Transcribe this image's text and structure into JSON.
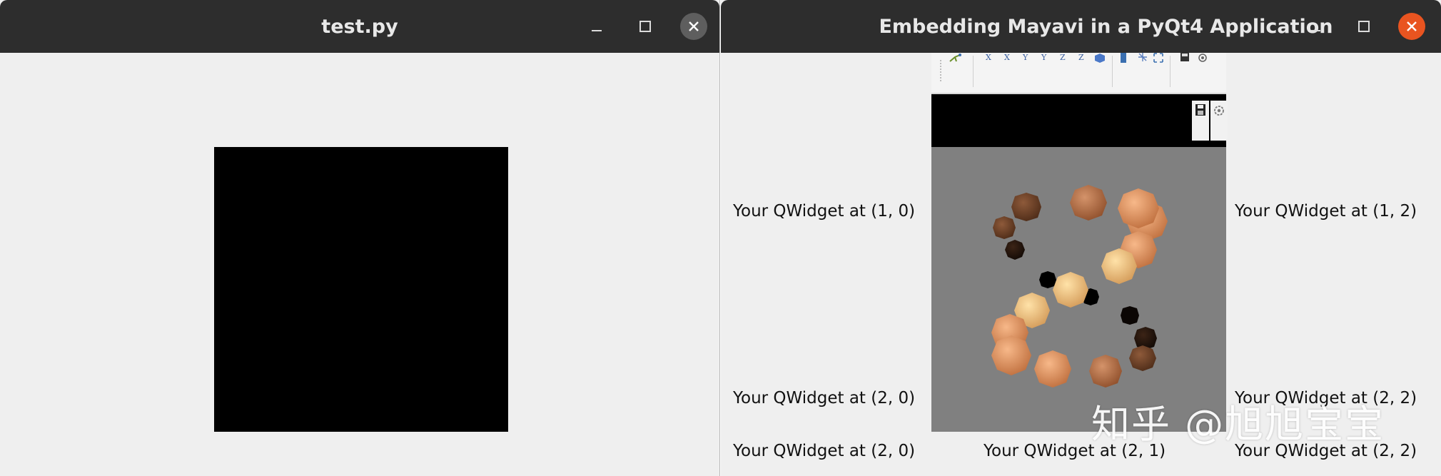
{
  "left_window": {
    "title": "test.py",
    "controls": {
      "minimize": "minimize-icon",
      "maximize": "maximize-icon",
      "close": "close-icon"
    },
    "close_color": "#5e5e5e",
    "canvas_color": "#000000"
  },
  "right_window": {
    "title": "Embedding Mayavi in a PyQt4 Application",
    "controls": {
      "minimize": "minimize-icon",
      "maximize": "maximize-icon",
      "close": "close-icon"
    },
    "close_color": "#e95420",
    "labels": {
      "r1c0": "Your QWidget at (1, 0)",
      "r1c2": "Your QWidget at (1, 2)",
      "r2c0_a": "Your QWidget at (2, 0)",
      "r2c2_a": "Your QWidget at (2, 2)",
      "r2c0_b": "Your QWidget at (2, 0)",
      "r2c1": "Your QWidget at (2, 1)",
      "r2c2_b": "Your QWidget at (2, 2)"
    },
    "mayavi": {
      "toolbar_icons": [
        "mayavi-logo-icon",
        "view-x-plus-icon",
        "view-x-minus-icon",
        "view-y-plus-icon",
        "view-y-minus-icon",
        "view-z-plus-icon",
        "view-z-minus-icon",
        "isometric-view-icon",
        "parallel-projection-icon",
        "full-screen-icon",
        "save-icon",
        "settings-icon"
      ],
      "axis_letters": [
        "X",
        "X",
        "Y",
        "Y",
        "Z",
        "Z"
      ],
      "scene_icons": [
        "save-icon",
        "settings-icon"
      ],
      "background_color": "#808080",
      "sphere_colors": [
        "#f2c87f",
        "#e8a16a",
        "#bf7c50",
        "#7a4a30",
        "#2a1a12"
      ]
    },
    "watermark": "知乎 @旭旭宝宝"
  }
}
